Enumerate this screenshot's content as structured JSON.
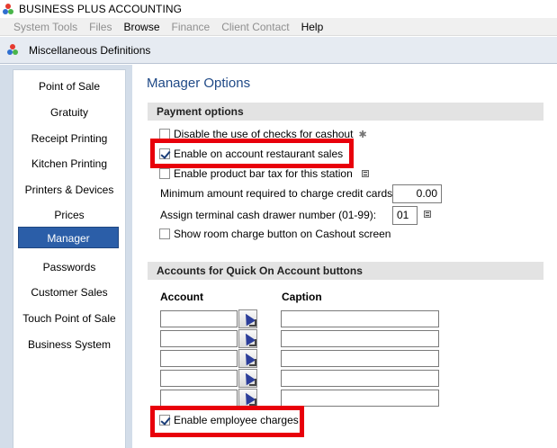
{
  "app": {
    "title": "BUSINESS PLUS ACCOUNTING"
  },
  "menu": {
    "items": [
      "System Tools",
      "Files",
      "Browse",
      "Finance",
      "Client Contact",
      "Help"
    ]
  },
  "window": {
    "title": "Miscellaneous Definitions"
  },
  "sidebar": {
    "items": [
      {
        "label": "Point of Sale"
      },
      {
        "label": "Gratuity"
      },
      {
        "label": "Receipt Printing"
      },
      {
        "label": "Kitchen Printing"
      },
      {
        "label": "Printers & Devices"
      },
      {
        "label": "Prices"
      },
      {
        "label": "Manager",
        "selected": true
      },
      {
        "label": "Passwords"
      },
      {
        "label": "Customer Sales"
      },
      {
        "label": "Touch Point of Sale"
      },
      {
        "label": "Business System"
      }
    ]
  },
  "main": {
    "title": "Manager Options",
    "payment": {
      "header": "Payment options",
      "disable_checks": {
        "label": "Disable the use of checks for cashout",
        "checked": false,
        "asterisk": "✱"
      },
      "enable_on_account": {
        "label": "Enable on account restaurant sales",
        "checked": true
      },
      "enable_bar_tax": {
        "label": "Enable product bar tax for this station",
        "checked": false
      },
      "min_amount": {
        "label": "Minimum amount required to charge credit cards:",
        "value": "0.00"
      },
      "cash_drawer": {
        "label": "Assign terminal cash drawer number (01-99):",
        "value": "01"
      },
      "room_charge": {
        "label": "Show room charge button on Cashout screen",
        "checked": false
      }
    },
    "accounts": {
      "header": "Accounts for Quick On Account buttons",
      "account_col": "Account",
      "caption_col": "Caption",
      "rows": [
        {
          "account": "",
          "caption": ""
        },
        {
          "account": "",
          "caption": ""
        },
        {
          "account": "",
          "caption": ""
        },
        {
          "account": "",
          "caption": ""
        },
        {
          "account": "",
          "caption": ""
        }
      ],
      "employee_charges": {
        "label": "Enable employee charges",
        "checked": true
      }
    }
  },
  "colors": {
    "accent": "#2b5ea8",
    "highlight": "#e8000b",
    "title": "#204a87"
  }
}
